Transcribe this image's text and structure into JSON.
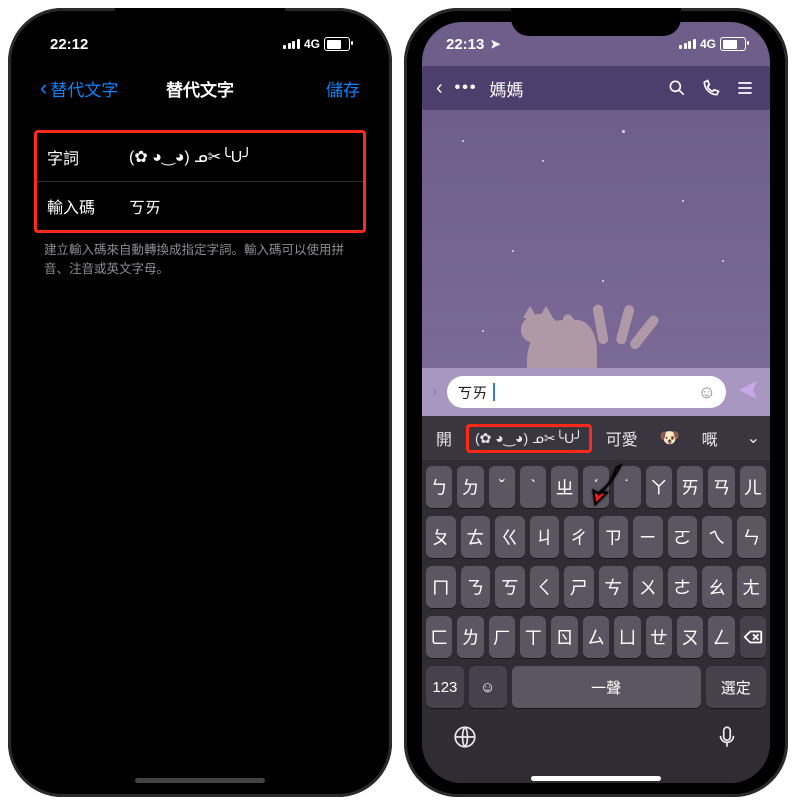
{
  "left": {
    "status": {
      "time": "22:12",
      "net": "4G"
    },
    "nav": {
      "back": "替代文字",
      "title": "替代文字",
      "save": "儲存"
    },
    "rows": {
      "phrase_label": "字詞",
      "phrase_value": "(✿ ◕‿◕) ᓄ✂╰U╯",
      "shortcut_label": "輸入碼",
      "shortcut_value": "ㄎㄞ"
    },
    "helper": "建立輸入碼來自動轉換成指定字詞。輸入碼可以使用拼音、注音或英文字母。"
  },
  "right": {
    "status": {
      "time": "22:13",
      "net": "4G"
    },
    "chat": {
      "name": "媽媽",
      "dots": "•••"
    },
    "input": {
      "text": "ㄎㄞ"
    },
    "suggestions": {
      "open": "開",
      "boxed": "(✿ ◕‿◕) ᓄ✂╰U╯",
      "cute": "可愛",
      "dog": "🐶",
      "last": "嘅"
    },
    "keyboard": {
      "row1": [
        "ㄅ",
        "ㄉ",
        "ˇ",
        "ˋ",
        "ㄓ",
        "ˊ",
        "˙",
        "ㄚ",
        "ㄞ",
        "ㄢ",
        "ㄦ"
      ],
      "row2": [
        "ㄆ",
        "ㄊ",
        "ㄍ",
        "ㄐ",
        "ㄔ",
        "ㄗ",
        "ㄧ",
        "ㄛ",
        "ㄟ",
        "ㄣ"
      ],
      "row3": [
        "ㄇ",
        "ㄋ",
        "ㄎ",
        "ㄑ",
        "ㄕ",
        "ㄘ",
        "ㄨ",
        "ㄜ",
        "ㄠ",
        "ㄤ"
      ],
      "row4_keys": [
        "ㄈ",
        "ㄌ",
        "ㄏ",
        "ㄒ",
        "ㄖ",
        "ㄙ",
        "ㄩ",
        "ㄝ",
        "ㄡ",
        "ㄥ"
      ],
      "row5": {
        "num": "123",
        "space": "一聲",
        "select": "選定"
      }
    }
  }
}
